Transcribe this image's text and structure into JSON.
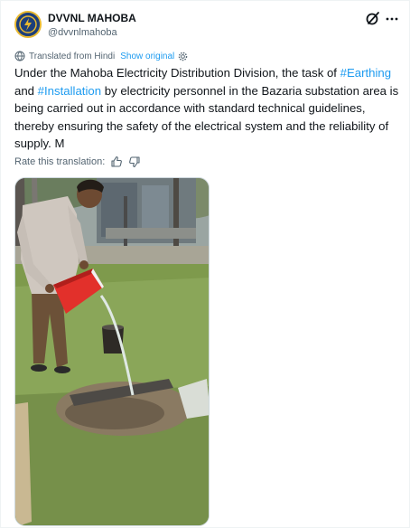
{
  "author": {
    "display_name": "DVVNL MAHOBA",
    "handle": "@dvvnlmahoba",
    "avatar_icon": "dvvnl-logo-icon"
  },
  "header_actions": {
    "grok_icon": "grok-icon",
    "more_icon": "more-options-icon"
  },
  "translation": {
    "icon": "globe-icon",
    "label": "Translated from Hindi",
    "show_original": "Show original",
    "settings_icon": "gear-icon"
  },
  "tweet": {
    "part1": "Under the Mahoba Electricity Distribution Division, the task of ",
    "hashtag1": "#Earthing",
    "part2": " and ",
    "hashtag2": "#Installation",
    "part3": " by electricity personnel in the Bazaria substation area is being carried out in accordance with standard technical guidelines, thereby ensuring the safety of the electrical system and the reliability of supply. M"
  },
  "rate": {
    "label": "Rate this translation:",
    "thumbs_up_icon": "thumbs-up-icon",
    "thumbs_down_icon": "thumbs-down-icon"
  },
  "colors": {
    "link": "#1d9bf0",
    "text": "#0f1419",
    "secondary": "#536471"
  }
}
